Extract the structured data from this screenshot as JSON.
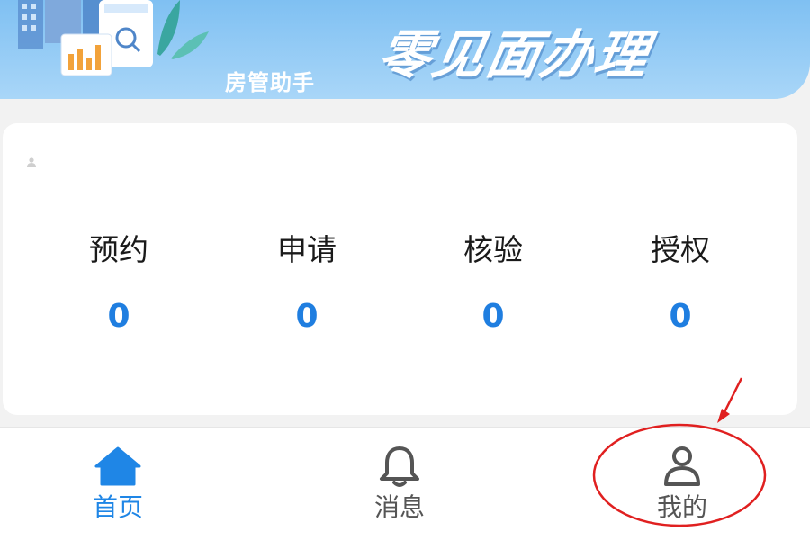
{
  "banner": {
    "subtitle": "房管助手",
    "title": "零见面办理",
    "gradient_top": "#7fc0f2",
    "gradient_bottom": "#a9d6f8"
  },
  "card": {
    "user_icon": "person-icon",
    "stats": [
      {
        "label": "预约",
        "value": "0"
      },
      {
        "label": "申请",
        "value": "0"
      },
      {
        "label": "核验",
        "value": "0"
      },
      {
        "label": "授权",
        "value": "0"
      }
    ],
    "value_color": "#1f7ee0"
  },
  "nav": {
    "items": [
      {
        "label": "首页",
        "icon": "home-icon",
        "active": true
      },
      {
        "label": "消息",
        "icon": "bell-icon",
        "active": false
      },
      {
        "label": "我的",
        "icon": "user-icon",
        "active": false
      }
    ],
    "active_color": "#1f86e6",
    "inactive_color": "#555555"
  },
  "annotation": {
    "color": "#e02020",
    "target": "我的"
  }
}
